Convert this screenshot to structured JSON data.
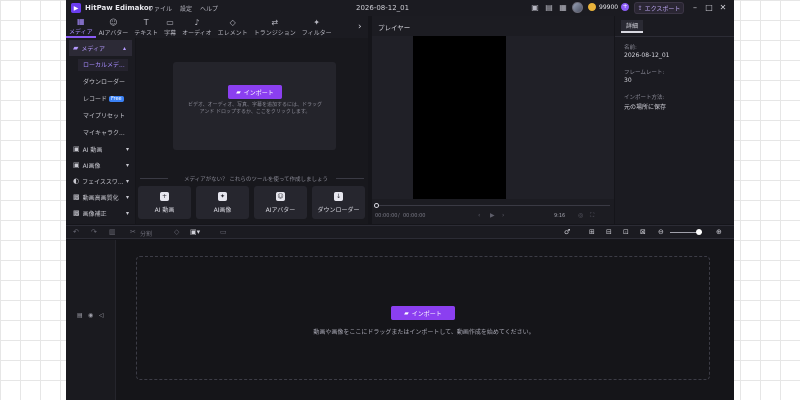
{
  "app": {
    "name": "HitPaw Edimakor",
    "document_title": "2026-08-12_01",
    "menu": [
      "ファイル",
      "設定",
      "ヘルプ"
    ],
    "credits": "99900",
    "export_label": "エクスポート"
  },
  "tabs": [
    {
      "label": "メディア",
      "icon": "media-icon"
    },
    {
      "label": "AIアバター",
      "icon": "avatar-icon"
    },
    {
      "label": "テキスト",
      "icon": "text-icon"
    },
    {
      "label": "字幕",
      "icon": "subtitle-icon"
    },
    {
      "label": "オーディオ",
      "icon": "audio-icon"
    },
    {
      "label": "エレメント",
      "icon": "element-icon"
    },
    {
      "label": "トランジション",
      "icon": "transition-icon"
    },
    {
      "label": "フィルター",
      "icon": "filter-icon"
    }
  ],
  "sidebar": {
    "media": "メディア",
    "sub_items": [
      "ローカルメデ...",
      "ダウンローダー",
      "レコード",
      "マイプリセット",
      "マイキャラク..."
    ],
    "free_badge": "Free",
    "sections": [
      "AI 動画",
      "AI画像",
      "フェイススワ...",
      "動画高画質化",
      "画像補正"
    ]
  },
  "media": {
    "import_label": "インポート",
    "drop_text": "ビデオ、オーディオ、写真、字幕を追加するには、ドラッグ アンド ドロップするか、ここをクリックします。",
    "tools_hint": "メディアがない？ これらのツールを使って作成しましょう",
    "tools": [
      "AI 動画",
      "AI画像",
      "AIアバター",
      "ダウンローダー"
    ]
  },
  "player": {
    "title": "プレイヤー",
    "time_current": "00:00:00",
    "time_total": "00:00:00",
    "ratio": "9:16"
  },
  "details": {
    "tab": "詳細",
    "fields": [
      {
        "label": "名前:",
        "value": "2026-08-12_01"
      },
      {
        "label": "フレームレート:",
        "value": "30"
      },
      {
        "label": "インポート方法:",
        "value": "元の場所に保存"
      }
    ]
  },
  "timeline": {
    "split_label": "分割",
    "import_label": "インポート",
    "drop_text": "動画や画像をここにドラッグまたはインポートして、動画作成を始めてください。"
  },
  "colors": {
    "accent": "#8b3ff0",
    "app_bg": "#15151a"
  }
}
